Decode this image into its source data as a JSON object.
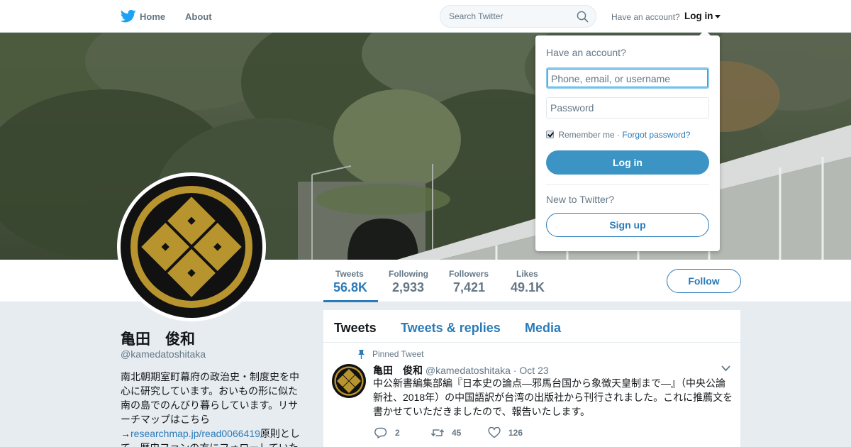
{
  "nav": {
    "home": "Home",
    "about": "About",
    "search_placeholder": "Search Twitter",
    "have_account": "Have an account?",
    "login": "Log in"
  },
  "login_dropdown": {
    "title": "Have an account?",
    "username_placeholder": "Phone, email, or username",
    "password_placeholder": "Password",
    "remember_me": "Remember me",
    "separator": "·",
    "forgot_password": "Forgot password?",
    "login_button": "Log in",
    "new_to_twitter": "New to Twitter?",
    "signup_button": "Sign up"
  },
  "profile_nav": {
    "stats": [
      {
        "label": "Tweets",
        "value": "56.8K"
      },
      {
        "label": "Following",
        "value": "2,933"
      },
      {
        "label": "Followers",
        "value": "7,421"
      },
      {
        "label": "Likes",
        "value": "49.1K"
      }
    ],
    "follow": "Follow"
  },
  "profile": {
    "name": "亀田　俊和",
    "handle": "@kamedatoshitaka",
    "bio_before_link": "南北朝期室町幕府の政治史・制度史を中心に研究しています。おいもの形に似た南の島でのんびり暮らしています。リサーチマップはこちら→",
    "bio_link": "researchmap.jp/read0066419",
    "bio_after_link": "原則として、歴史ファンの方にフォローしていた"
  },
  "timeline": {
    "tabs": [
      "Tweets",
      "Tweets & replies",
      "Media"
    ],
    "pinned_label": "Pinned Tweet",
    "tweet": {
      "name": "亀田　俊和",
      "handle": "@kamedatoshitaka",
      "date": "· Oct 23",
      "text": "中公新書編集部編『日本史の論点―邪馬台国から象徴天皇制まで―』（中央公論新社、2018年）の中国語訳が台湾の出版社から刊行されました。これに推薦文を書かせていただきましたので、報告いたします。",
      "replies": "2",
      "retweets": "45",
      "likes": "126"
    }
  },
  "colors": {
    "accent": "#2b7bb9",
    "twitter_blue": "#1da1f2",
    "background": "#e6ecf0",
    "crest_gold": "#b8942e",
    "crest_black": "#111111"
  }
}
